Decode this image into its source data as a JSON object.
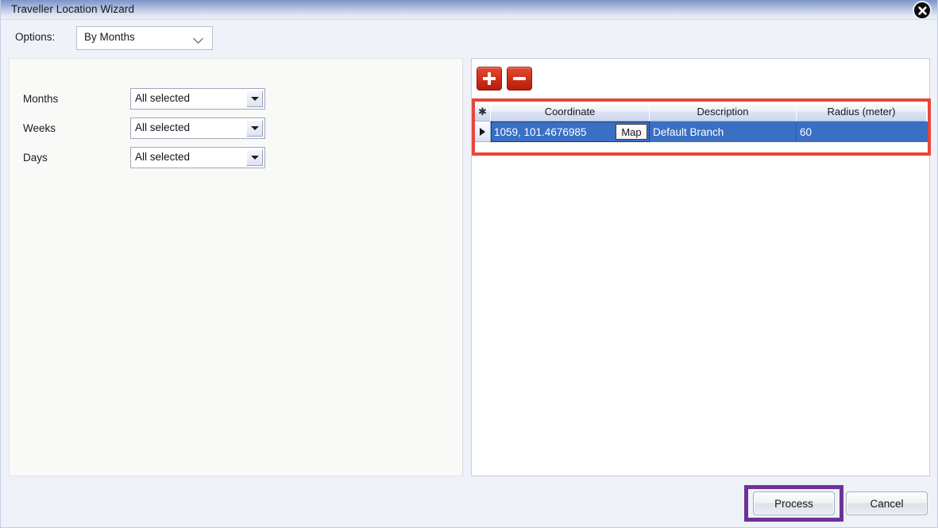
{
  "window": {
    "title": "Traveller Location Wizard",
    "close_icon": "close-x-icon"
  },
  "options_bar": {
    "label": "Options:",
    "selected": "By Months",
    "chevron_icon": "chevron-down-icon"
  },
  "left_panel": {
    "fields": [
      {
        "label": "Months",
        "value": "All selected",
        "arrow_icon": "triangle-down-icon"
      },
      {
        "label": "Weeks",
        "value": "All selected",
        "arrow_icon": "triangle-down-icon"
      },
      {
        "label": "Days",
        "value": "All selected",
        "arrow_icon": "triangle-down-icon"
      }
    ]
  },
  "right_panel": {
    "toolbar": {
      "add_label": "add-row-button",
      "add_icon": "plus-icon",
      "remove_label": "remove-row-button",
      "remove_icon": "minus-icon"
    },
    "grid": {
      "indicator_header_icon": "new-row-asterisk-icon",
      "columns": [
        "Coordinate",
        "Description",
        "Radius (meter)"
      ],
      "rows": [
        {
          "row_indicator_icon": "current-row-arrow-icon",
          "coordinate": "1059, 101.4676985",
          "map_button": "Map",
          "description": "Default Branch",
          "radius": "60"
        }
      ]
    }
  },
  "footer": {
    "process_label": "Process",
    "cancel_label": "Cancel"
  },
  "annotations": {
    "grid_highlight_color": "#e8463a",
    "process_highlight_color": "#6c3396"
  }
}
